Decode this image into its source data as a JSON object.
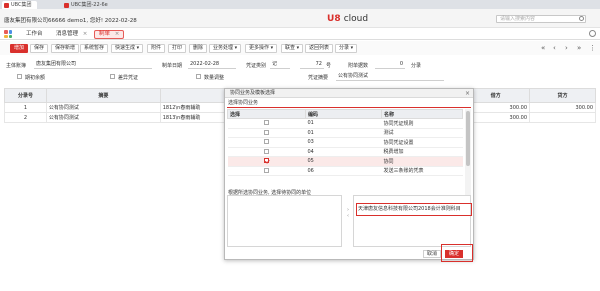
{
  "browser": {
    "tabs": [
      {
        "label": "UBC集团",
        "active": true
      },
      {
        "label": "UBC集团-22-6e",
        "active": false
      }
    ]
  },
  "header": {
    "company_info": "唐友集团有限公司66666 demo1, 您好! 2022-02-28",
    "logo_u": "U",
    "logo_text": "8",
    "logo_cloud": "cloud",
    "search_placeholder": "请输入搜索内容"
  },
  "nav": {
    "tabs": [
      {
        "label": "工作台"
      },
      {
        "label": "消息管理"
      },
      {
        "label": "制单"
      }
    ]
  },
  "toolbar": {
    "buttons": [
      {
        "label": "增加",
        "primary": true
      },
      {
        "label": "保存"
      },
      {
        "label": "保存新增"
      },
      {
        "label": "系统暂存"
      },
      {
        "label": "快速生成 ▾"
      },
      {
        "label": "附件"
      },
      {
        "label": "打印"
      },
      {
        "label": "删除"
      },
      {
        "label": "业务处理 ▾"
      },
      {
        "label": "更多操作 ▾"
      },
      {
        "label": "联查 ▾"
      },
      {
        "label": "返回列表"
      },
      {
        "label": "分录 ▾"
      }
    ]
  },
  "form": {
    "main_book_label": "主体账簿",
    "main_book_value": "唐友集团有限公司",
    "date_label": "制单日期",
    "date_value": "2022-02-28",
    "voucher_type_label": "凭证类别",
    "voucher_type_value": "记",
    "voucher_no": "72",
    "voucher_no_unit": "号",
    "attach_label": "附单据数",
    "attach_value": "0",
    "attach_unit": "分录",
    "check_amount": "期初余额",
    "check_diff": "差异凭证",
    "check_qty": "数量调整",
    "summary_label": "凭证摘要",
    "summary_value": "公有协同测试"
  },
  "grid": {
    "headers": [
      "分录号",
      "摘要",
      "科目",
      "原币",
      "借方",
      "贷方"
    ],
    "rows": [
      {
        "no": "1",
        "summary": "公有协同测试",
        "account": "1812\\n春雨辅助",
        "debit": "300.00",
        "credit": "300.00"
      },
      {
        "no": "2",
        "summary": "公有协同测试",
        "account": "1813\\n春雨辅助",
        "debit": "300.00",
        "credit": ""
      }
    ]
  },
  "modal": {
    "title": "协同业务及模板选择",
    "select_label": "选择协同业务",
    "columns": [
      "选择",
      "编码",
      "名称"
    ],
    "rows": [
      {
        "code": "01",
        "name": "协同凭证规则",
        "checked": false
      },
      {
        "code": "01",
        "name": "测试",
        "checked": false
      },
      {
        "code": "03",
        "name": "协同凭证设置",
        "checked": false
      },
      {
        "code": "04",
        "name": "税费增加",
        "checked": false
      },
      {
        "code": "05",
        "name": "协同",
        "checked": true
      },
      {
        "code": "06",
        "name": "发送三条账的凭表",
        "checked": false
      }
    ],
    "target_label": "根据所选协同业务, 选择待协同的单位",
    "selected_company": "天津唐友信息科技有限公司2018会计准则科目",
    "cancel_label": "取消",
    "ok_label": "确定"
  },
  "colors": {
    "accent": "#d9302c",
    "header_bg": "#eef0f3"
  }
}
